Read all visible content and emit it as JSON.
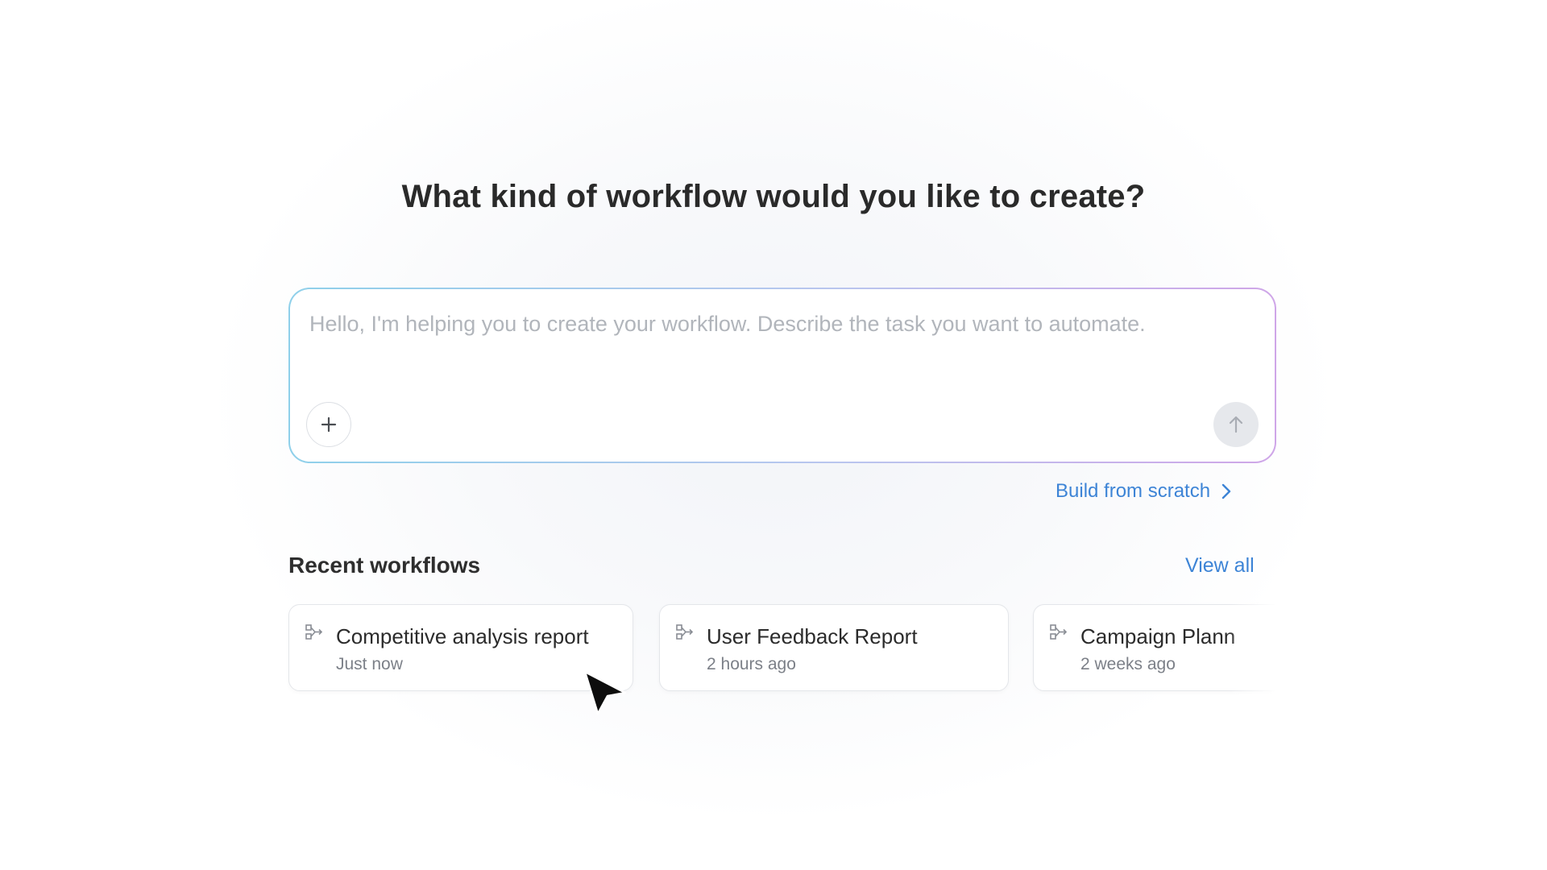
{
  "page": {
    "heading": "What kind of workflow would you like to create?"
  },
  "prompt": {
    "placeholder": "Hello, I'm helping you to create your workflow. Describe the task you want to automate.",
    "add_icon": "plus-icon",
    "send_icon": "arrow-up-icon"
  },
  "build_from_scratch": {
    "label": "Build from scratch",
    "icon": "chevron-right-icon"
  },
  "recent": {
    "title": "Recent workflows",
    "view_all_label": "View all",
    "items": [
      {
        "title": "Competitive analysis report",
        "time": "Just now",
        "icon": "workflow-icon"
      },
      {
        "title": "User Feedback Report",
        "time": "2 hours ago",
        "icon": "workflow-icon"
      },
      {
        "title": "Campaign Plann",
        "time": "2 weeks ago",
        "icon": "workflow-icon"
      }
    ]
  },
  "colors": {
    "link": "#3d84d6",
    "heading": "#2a2a2a",
    "gradient_start": "#8fd0ea",
    "gradient_end": "#cfa6e8",
    "send_button_bg": "#e6e8ec"
  }
}
